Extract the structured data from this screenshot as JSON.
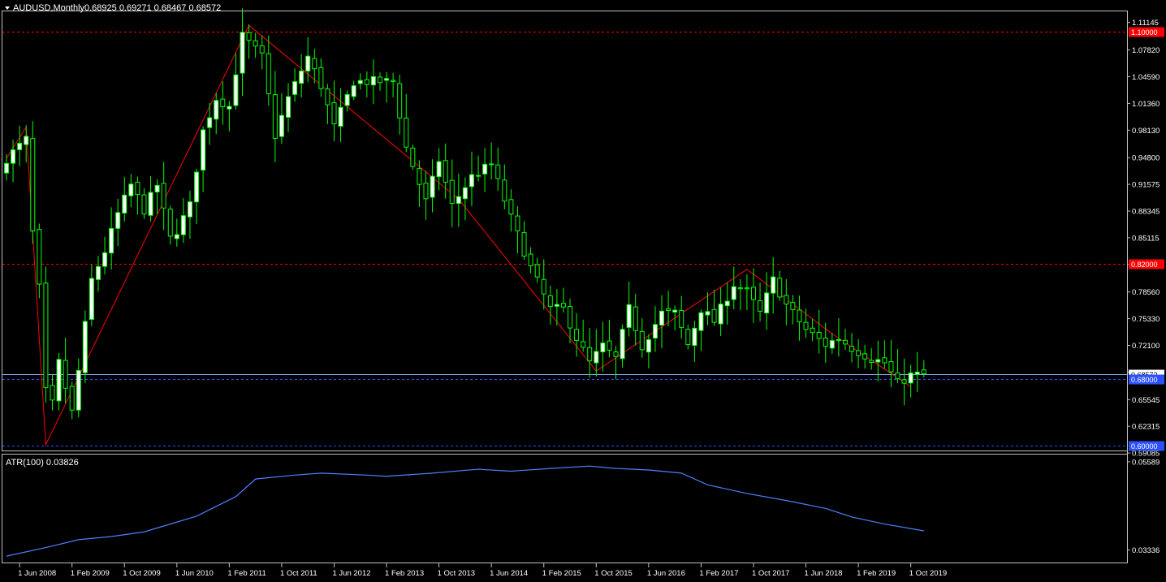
{
  "header": {
    "symbol_label": "AUDUSD,Monthly",
    "ohlc_label": "0.68925 0.69271 0.68467 0.68572"
  },
  "indicator": {
    "label": "ATR(100) 0.03826"
  },
  "colors": {
    "background": "#000000",
    "frame": "#c0c0c0",
    "bull_candle": "#ffffff",
    "bear_candle": "#000000",
    "wick": "#00ff00",
    "zigzag": "#ff0000",
    "atr_line": "#4f7fff",
    "resistance_line": "#ff0000",
    "support_line": "#2b50ff",
    "current_price_line": "#8fb1ff"
  },
  "chart_data": [
    {
      "type": "candlestick",
      "title": "",
      "symbol": "AUDUSD",
      "timeframe": "Monthly",
      "ylim": [
        0.5939,
        1.1249
      ],
      "y_ticks": [
        "1.11145",
        "1.07820",
        "1.04590",
        "1.01360",
        "0.98130",
        "0.94800",
        "0.91575",
        "0.88345",
        "0.85115",
        "0.81885",
        "0.78560",
        "0.75330",
        "0.72100",
        "0.68870",
        "0.65545",
        "0.62315",
        "0.59085"
      ],
      "y_tick_values": [
        1.11145,
        1.0782,
        1.0459,
        1.0136,
        0.9813,
        0.948,
        0.91575,
        0.88345,
        0.85115,
        0.81885,
        0.7856,
        0.7533,
        0.721,
        0.6887,
        0.65545,
        0.62315,
        0.59085
      ],
      "x_ticks": [
        "1 Jun 2008",
        "1 Feb 2009",
        "1 Oct 2009",
        "1 Jun 2010",
        "1 Feb 2011",
        "1 Oct 2011",
        "1 Jun 2012",
        "1 Feb 2013",
        "1 Oct 2013",
        "1 Jun 2014",
        "1 Feb 2015",
        "1 Oct 2015",
        "1 Jun 2016",
        "1 Feb 2017",
        "1 Oct 2017",
        "1 Jun 2018",
        "1 Feb 2019",
        "1 Oct 2019"
      ],
      "x_tick_bar_index": [
        2,
        10,
        18,
        26,
        34,
        42,
        50,
        58,
        66,
        74,
        82,
        90,
        98,
        106,
        114,
        122,
        130,
        138
      ],
      "first_bar": "2008-04",
      "last_bar": "2019-12",
      "close_path": [
        [
          "2008-04",
          0.947
        ],
        [
          "2008-07",
          0.97
        ],
        [
          "2008-08",
          0.857
        ],
        [
          "2008-09",
          0.79
        ],
        [
          "2008-10",
          0.665
        ],
        [
          "2008-11",
          0.65
        ],
        [
          "2008-12",
          0.7
        ],
        [
          "2009-02",
          0.64
        ],
        [
          "2009-03",
          0.69
        ],
        [
          "2009-05",
          0.8
        ],
        [
          "2009-07",
          0.835
        ],
        [
          "2009-09",
          0.88
        ],
        [
          "2009-11",
          0.915
        ],
        [
          "2010-01",
          0.885
        ],
        [
          "2010-03",
          0.915
        ],
        [
          "2010-05",
          0.85
        ],
        [
          "2010-06",
          0.86
        ],
        [
          "2010-08",
          0.89
        ],
        [
          "2010-10",
          0.98
        ],
        [
          "2010-12",
          1.02
        ],
        [
          "2011-02",
          1.01
        ],
        [
          "2011-04",
          1.095
        ],
        [
          "2011-07",
          1.07
        ],
        [
          "2011-09",
          0.975
        ],
        [
          "2011-11",
          1.02
        ],
        [
          "2012-02",
          1.07
        ],
        [
          "2012-04",
          1.035
        ],
        [
          "2012-06",
          0.985
        ],
        [
          "2012-09",
          1.04
        ],
        [
          "2012-12",
          1.04
        ],
        [
          "2013-03",
          1.04
        ],
        [
          "2013-05",
          0.96
        ],
        [
          "2013-08",
          0.895
        ],
        [
          "2013-10",
          0.945
        ],
        [
          "2013-12",
          0.89
        ],
        [
          "2014-03",
          0.925
        ],
        [
          "2014-06",
          0.94
        ],
        [
          "2014-09",
          0.875
        ],
        [
          "2014-12",
          0.815
        ],
        [
          "2015-03",
          0.765
        ],
        [
          "2015-05",
          0.765
        ],
        [
          "2015-07",
          0.73
        ],
        [
          "2015-09",
          0.7
        ],
        [
          "2015-11",
          0.72
        ],
        [
          "2016-01",
          0.705
        ],
        [
          "2016-03",
          0.765
        ],
        [
          "2016-05",
          0.72
        ],
        [
          "2016-08",
          0.76
        ],
        [
          "2016-10",
          0.76
        ],
        [
          "2016-12",
          0.722
        ],
        [
          "2017-02",
          0.765
        ],
        [
          "2017-04",
          0.75
        ],
        [
          "2017-07",
          0.795
        ],
        [
          "2017-09",
          0.785
        ],
        [
          "2017-11",
          0.76
        ],
        [
          "2018-01",
          0.8
        ],
        [
          "2018-03",
          0.77
        ],
        [
          "2018-06",
          0.74
        ],
        [
          "2018-09",
          0.722
        ],
        [
          "2018-11",
          0.73
        ],
        [
          "2019-01",
          0.718
        ],
        [
          "2019-04",
          0.705
        ],
        [
          "2019-06",
          0.7
        ],
        [
          "2019-08",
          0.675
        ],
        [
          "2019-10",
          0.685
        ],
        [
          "2019-12",
          0.6857
        ]
      ],
      "zigzag": [
        [
          "2008-04",
          0.947
        ],
        [
          "2008-07",
          0.985
        ],
        [
          "2008-10",
          0.601
        ],
        [
          "2011-05",
          1.108
        ],
        [
          "2014-01",
          0.898
        ],
        [
          "2015-10",
          0.69
        ],
        [
          "2017-09",
          0.813
        ],
        [
          "2018-10",
          0.735
        ],
        [
          "2019-10",
          0.671
        ]
      ],
      "levels": [
        {
          "label": "1.10000",
          "value": 1.1,
          "color": "#ff0000",
          "style": "dashed"
        },
        {
          "label": "0.82000",
          "value": 0.82,
          "color": "#ff0000",
          "style": "dashed"
        },
        {
          "label": "0.68572",
          "value": 0.68572,
          "color": "#8fb1ff",
          "style": "solid"
        },
        {
          "label": "0.68000",
          "value": 0.68,
          "color": "#2b50ff",
          "style": "dashed"
        },
        {
          "label": "0.60000",
          "value": 0.6,
          "color": "#2b50ff",
          "style": "dashed"
        }
      ]
    },
    {
      "type": "line",
      "title": "ATR(100) 0.03826",
      "ylim": [
        0.031,
        0.0565
      ],
      "y_ticks": [
        "0.05589",
        "0.03336"
      ],
      "y_tick_values": [
        0.05589,
        0.03336
      ],
      "series": [
        {
          "name": "ATR(100)",
          "points": [
            [
              "2008-04",
              0.0318
            ],
            [
              "2008-10",
              0.034
            ],
            [
              "2009-03",
              0.036
            ],
            [
              "2009-08",
              0.0368
            ],
            [
              "2010-01",
              0.038
            ],
            [
              "2010-04",
              0.0395
            ],
            [
              "2010-09",
              0.042
            ],
            [
              "2011-03",
              0.047
            ],
            [
              "2011-06",
              0.0515
            ],
            [
              "2011-12",
              0.0525
            ],
            [
              "2012-04",
              0.053
            ],
            [
              "2012-11",
              0.0525
            ],
            [
              "2013-02",
              0.0522
            ],
            [
              "2013-09",
              0.053
            ],
            [
              "2014-04",
              0.054
            ],
            [
              "2014-09",
              0.0535
            ],
            [
              "2015-03",
              0.0542
            ],
            [
              "2015-09",
              0.0548
            ],
            [
              "2016-01",
              0.0542
            ],
            [
              "2016-06",
              0.0538
            ],
            [
              "2016-11",
              0.053
            ],
            [
              "2017-03",
              0.05
            ],
            [
              "2017-09",
              0.0478
            ],
            [
              "2018-03",
              0.046
            ],
            [
              "2018-09",
              0.044
            ],
            [
              "2019-01",
              0.0418
            ],
            [
              "2019-06",
              0.04
            ],
            [
              "2019-12",
              0.03826
            ]
          ]
        }
      ]
    }
  ]
}
